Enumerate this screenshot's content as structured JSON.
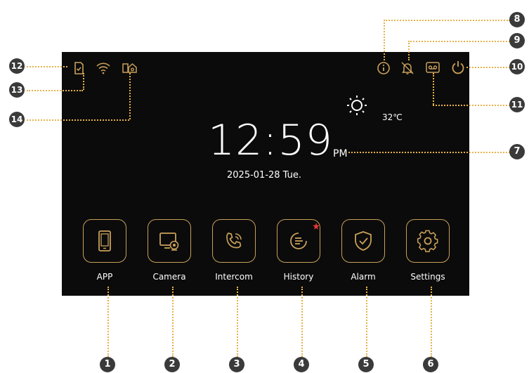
{
  "status_bar": {
    "left_icons": [
      "sd-card-icon",
      "wifi-icon",
      "device-home-icon"
    ],
    "right_icons": [
      "info-icon",
      "bell-off-icon",
      "voicemail-icon",
      "power-icon"
    ]
  },
  "clock": {
    "time": "12:59",
    "ampm": "PM",
    "date": "2025-01-28  Tue.",
    "temperature": "32℃"
  },
  "apps": [
    {
      "label": "APP",
      "icon": "phone-icon"
    },
    {
      "label": "Camera",
      "icon": "camera-icon"
    },
    {
      "label": "Intercom",
      "icon": "call-icon"
    },
    {
      "label": "History",
      "icon": "history-icon",
      "badge": true
    },
    {
      "label": "Alarm",
      "icon": "shield-check-icon"
    },
    {
      "label": "Settings",
      "icon": "gear-icon"
    }
  ],
  "callouts": [
    "1",
    "2",
    "3",
    "4",
    "5",
    "6",
    "7",
    "8",
    "9",
    "10",
    "11",
    "12",
    "13",
    "14"
  ],
  "colors": {
    "accent": "#c9a05a",
    "leader": "#e6b24a",
    "screen": "#0b0b0b",
    "badge": "#e53935"
  }
}
